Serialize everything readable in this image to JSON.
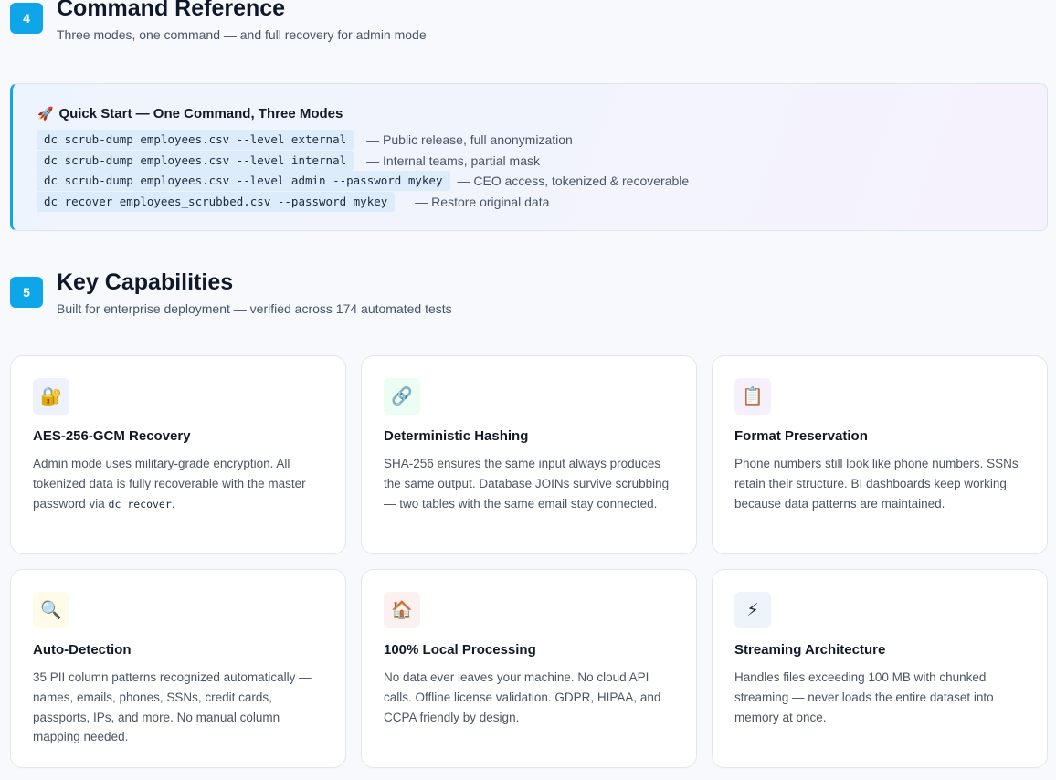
{
  "section4": {
    "number": "4",
    "title": "Command Reference",
    "subtitle": "Three modes, one command — and full recovery for admin mode"
  },
  "quickstart": {
    "icon": "rocket-icon",
    "title": "Quick Start — One Command, Three Modes",
    "commands": [
      {
        "code": "dc scrub-dump employees.csv --level external",
        "desc": "— Public release, full anonymization"
      },
      {
        "code": "dc scrub-dump employees.csv --level internal",
        "desc": "— Internal teams, partial mask"
      },
      {
        "code": "dc scrub-dump employees.csv --level admin --password mykey",
        "desc": "— CEO access, tokenized & recoverable"
      },
      {
        "code": "dc recover employees_scrubbed.csv --password mykey",
        "desc": "— Restore original data"
      }
    ]
  },
  "section5": {
    "number": "5",
    "title": "Key Capabilities",
    "subtitle": "Built for enterprise deployment — verified across 174 automated tests"
  },
  "cards": [
    {
      "icon": "lock-icon",
      "title": "AES-256-GCM Recovery",
      "desc_before": "Admin mode uses military-grade encryption. All tokenized data is fully recoverable with the master password via ",
      "desc_code": "dc recover",
      "desc_after": "."
    },
    {
      "icon": "link-icon",
      "title": "Deterministic Hashing",
      "desc_before": "SHA-256 ensures the same input always produces the same output. Database JOINs survive scrubbing — two tables with the same email stay connected.",
      "desc_code": "",
      "desc_after": ""
    },
    {
      "icon": "clipboard-icon",
      "title": "Format Preservation",
      "desc_before": "Phone numbers still look like phone numbers. SSNs retain their structure. BI dashboards keep working because data patterns are maintained.",
      "desc_code": "",
      "desc_after": ""
    },
    {
      "icon": "magnifier-icon",
      "title": "Auto-Detection",
      "desc_before": "35 PII column patterns recognized automatically — names, emails, phones, SSNs, credit cards, passports, IPs, and more. No manual column mapping needed.",
      "desc_code": "",
      "desc_after": ""
    },
    {
      "icon": "house-icon",
      "title": "100% Local Processing",
      "desc_before": "No data ever leaves your machine. No cloud API calls. Offline license validation. GDPR, HIPAA, and CCPA friendly by design.",
      "desc_code": "",
      "desc_after": ""
    },
    {
      "icon": "lightning-icon",
      "title": "Streaming Architecture",
      "desc_before": "Handles files exceeding 100 MB with chunked streaming — never loads the entire dataset into memory at once.",
      "desc_code": "",
      "desc_after": ""
    }
  ],
  "colors": {
    "accent": "#0ea5e9",
    "code_bg": "#dcecfb"
  }
}
